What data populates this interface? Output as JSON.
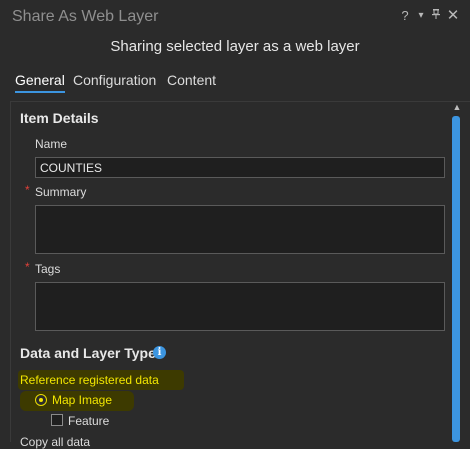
{
  "window": {
    "title": "Share As Web Layer",
    "controls": {
      "help": "?",
      "menu": "▾",
      "pin": "📌",
      "close": "✕"
    }
  },
  "subtitle": "Sharing selected layer as a web layer",
  "tabs": [
    {
      "label": "General",
      "selected": true
    },
    {
      "label": "Configuration",
      "selected": false
    },
    {
      "label": "Content",
      "selected": false
    }
  ],
  "item_details": {
    "heading": "Item Details",
    "name": {
      "label": "Name",
      "value": "COUNTIES"
    },
    "summary": {
      "label": "Summary",
      "required_marker": "*",
      "value": ""
    },
    "tags": {
      "label": "Tags",
      "required_marker": "*",
      "value": ""
    }
  },
  "data_layer_type": {
    "heading": "Data and Layer Type",
    "info_icon": "i",
    "reference_label": "Reference registered data",
    "options": [
      {
        "label": "Map Image",
        "type": "radio",
        "selected": true
      },
      {
        "label": "Feature",
        "type": "checkbox",
        "checked": false
      }
    ],
    "next_heading_partial": "Copy all data"
  },
  "colors": {
    "accent": "#3c95e0",
    "highlight_text": "#f2e600",
    "required": "#e0413a",
    "background": "#2b2b2b"
  }
}
